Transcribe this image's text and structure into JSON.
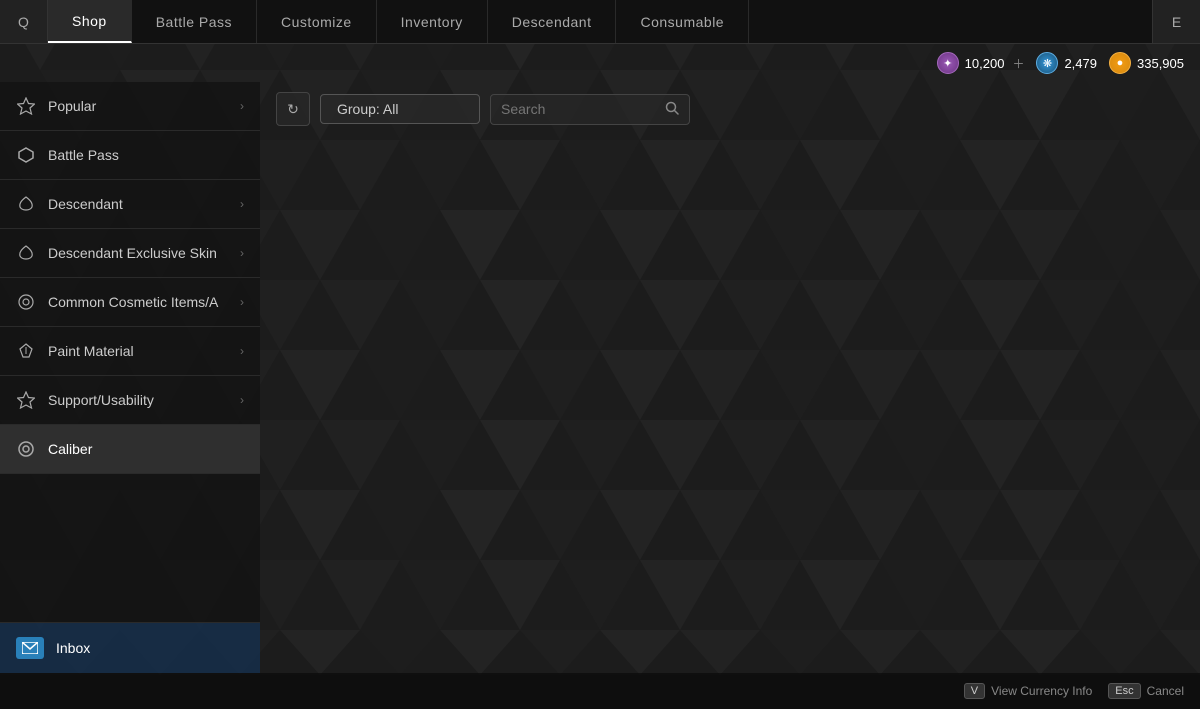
{
  "nav": {
    "left_icon": "Q",
    "right_icon": "E",
    "tabs": [
      {
        "id": "shop",
        "label": "Shop",
        "active": true
      },
      {
        "id": "battle-pass",
        "label": "Battle Pass",
        "active": false
      },
      {
        "id": "customize",
        "label": "Customize",
        "active": false
      },
      {
        "id": "inventory",
        "label": "Inventory",
        "active": false
      },
      {
        "id": "descendant",
        "label": "Descendant",
        "active": false
      },
      {
        "id": "consumable",
        "label": "Consumable",
        "active": false
      }
    ]
  },
  "currency": [
    {
      "id": "purple",
      "value": "10,200",
      "has_plus": true,
      "type": "purple"
    },
    {
      "id": "blue",
      "value": "2,479",
      "has_plus": false,
      "type": "blue"
    },
    {
      "id": "gold",
      "value": "335,905",
      "has_plus": false,
      "type": "gold"
    }
  ],
  "sidebar": {
    "items": [
      {
        "id": "popular",
        "label": "Popular",
        "has_arrow": true,
        "icon": "✦",
        "active": false
      },
      {
        "id": "battle-pass",
        "label": "Battle Pass",
        "has_arrow": false,
        "icon": "⬡",
        "active": false
      },
      {
        "id": "descendant",
        "label": "Descendant",
        "has_arrow": true,
        "icon": "❧",
        "active": false
      },
      {
        "id": "descendant-exclusive",
        "label": "Descendant Exclusive Skin",
        "has_arrow": true,
        "icon": "❧",
        "active": false
      },
      {
        "id": "common-cosmetic",
        "label": "Common Cosmetic Items/A",
        "has_arrow": true,
        "icon": "✿",
        "active": false
      },
      {
        "id": "paint-material",
        "label": "Paint Material",
        "has_arrow": true,
        "icon": "◈",
        "active": false
      },
      {
        "id": "support-usability",
        "label": "Support/Usability",
        "has_arrow": true,
        "icon": "✦",
        "active": false
      },
      {
        "id": "caliber",
        "label": "Caliber",
        "has_arrow": false,
        "icon": "◎",
        "active": true
      }
    ],
    "inbox": {
      "label": "Inbox",
      "icon": "✉"
    }
  },
  "filter": {
    "refresh_label": "↻",
    "group_label": "Group: All",
    "search_placeholder": "Search"
  },
  "bottom": {
    "view_currency_key": "V",
    "view_currency_label": "View Currency Info",
    "cancel_key": "Esc",
    "cancel_label": "Cancel"
  }
}
